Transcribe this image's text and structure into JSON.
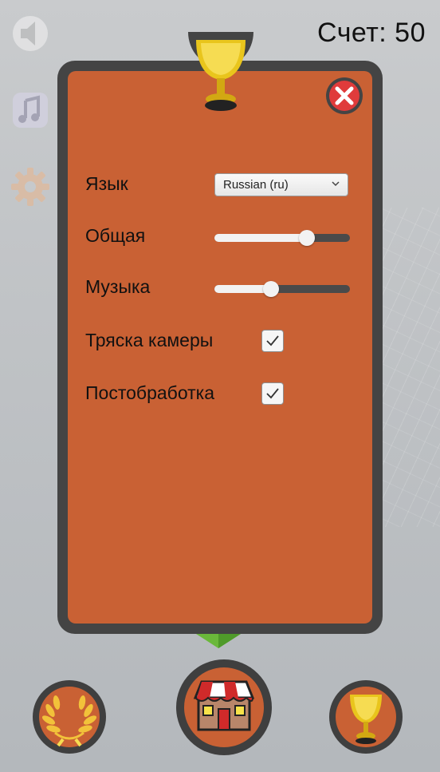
{
  "hud": {
    "score": "Счет: 50"
  },
  "side": [
    {
      "name": "sound-icon"
    },
    {
      "name": "music-icon"
    },
    {
      "name": "settings-icon"
    }
  ],
  "settings": {
    "language": {
      "label": "Язык",
      "value": "Russian (ru)"
    },
    "general": {
      "label": "Общая",
      "value": 0.68
    },
    "music": {
      "label": "Музыка",
      "value": 0.42
    },
    "camera_shake": {
      "label": "Тряска камеры",
      "checked": true
    },
    "postprocessing": {
      "label": "Постобработка",
      "checked": true
    }
  },
  "bottom_nav": [
    {
      "name": "achievements-wreath-icon"
    },
    {
      "name": "shop-icon"
    },
    {
      "name": "trophy-icon"
    }
  ],
  "colors": {
    "panel": "#c96134",
    "frame": "#444444",
    "close": "#e03b3b",
    "arrow": "#6ab83a"
  }
}
